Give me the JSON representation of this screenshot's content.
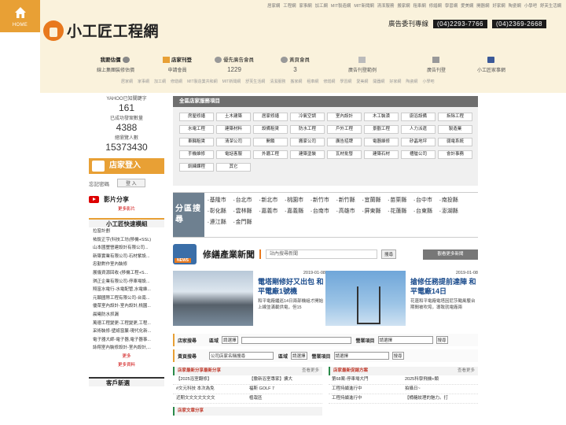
{
  "home": "HOME",
  "top_links": [
    "居家網",
    "工程網",
    "家事網",
    "加工網",
    "MIT製造網",
    "MIT新聞網",
    "清潔服務",
    "搬家網",
    "租車網",
    "修繕網",
    "學習網",
    "愛美網",
    "開器網",
    "好家網",
    "陶瓷網",
    "小學吧",
    "舒芙生活網"
  ],
  "site": {
    "name": "小工匠工程網"
  },
  "ad": {
    "label": "廣告委刊專線",
    "phone1": "(04)2293-7766",
    "phone2": "(04)2369-2668"
  },
  "features": [
    {
      "title": "我要估價",
      "sub": "線上集團裝修估價"
    },
    {
      "title": "店家刊登",
      "sub": "申請會員"
    },
    {
      "title": "優先廣告會員",
      "sub": "1229"
    },
    {
      "title": "黃頁會員",
      "sub": "3"
    },
    {
      "title": "",
      "sub": "廣告刊登範例"
    },
    {
      "title": "",
      "sub": "廣告刊登"
    },
    {
      "title": "",
      "sub": "小工匠家事網"
    }
  ],
  "sub_nav": [
    "居家網",
    "家事網",
    "加工網",
    "修繕網",
    "MIT製造業共和網",
    "MIT新聞網",
    "舒芙生活網",
    "清潔服務",
    "搬家網",
    "租車網",
    "修繕網",
    "學習網",
    "愛美網",
    "開器網",
    "好家網",
    "陶瓷網",
    "小學吧"
  ],
  "stats": [
    {
      "label": "YAHOO已知關鍵字",
      "value": "161"
    },
    {
      "label": "已成功發案數量",
      "value": "4388"
    },
    {
      "label": "總瀏覽人數",
      "value": "15373430"
    }
  ],
  "login": {
    "title": "店家登入",
    "forgot": "忘記密碼",
    "button": "登 入"
  },
  "video": {
    "title": "影片分享",
    "more": "更多影片"
  },
  "quick": {
    "title": "小工匠快速模組",
    "items": [
      "拉窗計劃",
      "祐銳正宇(科技工坊(移機+SSL)",
      "山本國豐營建設計有限公司...",
      "新築實業有限公司-石材紫設...",
      "忠勤對作室內裝修",
      "展儀資源回收-(移機工程+S...",
      "琪正企業有限公司-停車場設...",
      "翔富水電行-水電配管,水電維...",
      "元穎國際工程有限公司-台南...",
      "優菜室內設計-室內設計,桃園...",
      "晨曦防水抓漏",
      "萬德工程變更-工程變更,工程...",
      "采術裝修-壁紙窗簾-現代化新...",
      "電子器大師-電子器,電子器事...",
      "詠翔室內裝修設計-室內設計,..."
    ],
    "more1": "更多",
    "more2": "更多資料"
  },
  "clients": {
    "title": "客戶新選"
  },
  "categories": {
    "title": "全區店家服務項目",
    "rows": [
      [
        "房屋修繕",
        "土木建築",
        "居家修繕",
        "冷氣空調",
        "室內設計",
        "木工裝潢",
        "廚浴設備",
        "拆除工程"
      ],
      [
        "水電工程",
        "建築材料",
        "設備租賃",
        "防水工程",
        "戶外工程",
        "景觀工程",
        "人力派遣",
        "製造業"
      ],
      [
        "車輛租賃",
        "清潔公司",
        "開鎖",
        "搬家公司",
        "廣告招牌",
        "電器維修",
        "矽晶地坪",
        "弱電系統"
      ],
      [
        "手機維修",
        "電話客服",
        "外牆工程",
        "建築塗裝",
        "瓦材批發",
        "建築石材",
        "槽艙公司",
        "會計事務"
      ],
      [
        "訓練課程",
        "其它"
      ]
    ]
  },
  "regions": {
    "label": "分區搜尋",
    "rows": [
      [
        "基隆市",
        "台北市",
        "新北市",
        "桃園市",
        "新竹市",
        "新竹縣",
        "宜蘭縣",
        "苗栗縣",
        "台中市",
        "南投縣"
      ],
      [
        "彰化縣",
        "雲林縣",
        "嘉義市",
        "嘉義縣",
        "台南市",
        "高雄市",
        "屏東縣",
        "花蓮縣",
        "台東縣",
        "澎湖縣"
      ],
      [
        "連江縣",
        "金門縣"
      ]
    ]
  },
  "news": {
    "title": "修繕產業新聞",
    "badge": "NEWS",
    "search_placeholder": "站內搜尋新聞",
    "search_button": "搜尋",
    "more": "觀看更多新聞",
    "items": [
      {
        "date": "2019-01-08",
        "headline": "電塔剛修好又出包 和平電廠1號機",
        "body": "和平電廠繼巡14日兩部機組才開始上線並滿載供電，但15"
      },
      {
        "date": "2019-01-08",
        "headline": "搶修任務提前達陣 和平電廠14日",
        "body": "花蓮和平電廠電塔因尼莎颱風襲台期間被吹垮，導致就電廠兩"
      }
    ]
  },
  "store_search": {
    "label": "店家搜尋",
    "region_label": "區域",
    "region_value": "請選擇",
    "category_label": "營業項目",
    "category_value": "請選擇",
    "button": "搜尋"
  },
  "yellow_search": {
    "label": "黃頁搜尋",
    "input_value": "公司店家名稱搜尋",
    "region_label": "區域",
    "region_value": "請選擇",
    "category_label": "營業項目",
    "category_value": "請選擇",
    "button": "搜尋"
  },
  "promo_list": {
    "title": "店家最新分享最新分享",
    "more": "查看更多",
    "rows": [
      [
        "【2025浴室翻修】",
        "【撒新浴室專家】擴大"
      ],
      [
        "#文元科技 本次為免",
        "福斯 GOLF 7"
      ],
      [
        "近期文文文文文文文",
        "植栽區"
      ]
    ]
  },
  "discount_list": {
    "title": "店家最新促銷方案",
    "more": "查看更多",
    "rows": [
      [
        "第68案-停車場大門",
        "2025科學飛機+類"
      ],
      [
        "工程持續進行中",
        "拍攝日~"
      ],
      [
        "工程持續進行中",
        "【桶糖紋理的魅力。打"
      ]
    ]
  },
  "article": {
    "title": "店家文章分享"
  }
}
